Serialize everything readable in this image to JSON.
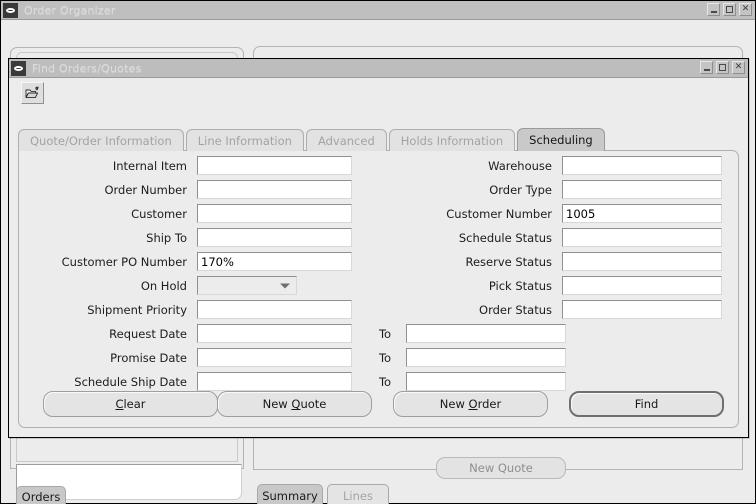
{
  "app_window": {
    "title": "Order Organizer",
    "window_controls": [
      "minimize",
      "maximize",
      "close"
    ],
    "bottom_tabs_left": [
      {
        "label": "Orders",
        "active": true
      }
    ],
    "bottom_tabs_right": [
      {
        "label": "Summary",
        "active": true
      },
      {
        "label": "Lines",
        "active": false
      }
    ],
    "obscured_button": {
      "label": "New Quote",
      "mnemonic": "Q"
    }
  },
  "dialog": {
    "title": "Find  Orders/Quotes",
    "window_controls": [
      "minimize",
      "maximize",
      "close"
    ],
    "toolbar": {
      "buttons": [
        {
          "name": "open-folder-icon",
          "label": ""
        }
      ]
    },
    "tabs": [
      {
        "label": "Quote/Order Information",
        "active": false
      },
      {
        "label": "Line Information",
        "active": false
      },
      {
        "label": "Advanced",
        "active": false
      },
      {
        "label": "Holds Information",
        "active": false
      },
      {
        "label": "Scheduling",
        "active": true
      }
    ],
    "left_fields": [
      {
        "label": "Internal Item",
        "value": "",
        "type": "text"
      },
      {
        "label": "Order Number",
        "value": "",
        "type": "text"
      },
      {
        "label": "Customer",
        "value": "",
        "type": "text"
      },
      {
        "label": "Ship To",
        "value": "",
        "type": "text"
      },
      {
        "label": "Customer PO Number",
        "value": "170%",
        "type": "text"
      },
      {
        "label": "On Hold",
        "value": "",
        "type": "combo"
      },
      {
        "label": "Shipment Priority",
        "value": "",
        "type": "text"
      }
    ],
    "date_fields": [
      {
        "label": "Request Date",
        "value": "",
        "to_label": "To",
        "to_value": ""
      },
      {
        "label": "Promise Date",
        "value": "",
        "to_label": "To",
        "to_value": ""
      },
      {
        "label": "Schedule Ship Date",
        "value": "",
        "to_label": "To",
        "to_value": ""
      }
    ],
    "right_fields": [
      {
        "label": "Warehouse",
        "value": "",
        "type": "text"
      },
      {
        "label": "Order Type",
        "value": "",
        "type": "text"
      },
      {
        "label": "Customer Number",
        "value": "1005",
        "type": "text"
      },
      {
        "label": "Schedule Status",
        "value": "",
        "type": "text"
      },
      {
        "label": "Reserve Status",
        "value": "",
        "type": "text"
      },
      {
        "label": "Pick Status",
        "value": "",
        "type": "text"
      },
      {
        "label": "Order Status",
        "value": "",
        "type": "text"
      }
    ],
    "buttons": [
      {
        "label": "Clear",
        "mnemonic": "C",
        "default": false
      },
      {
        "label": "New Quote",
        "mnemonic": "Q",
        "default": false
      },
      {
        "label": "New Order",
        "mnemonic": "O",
        "default": false
      },
      {
        "label": "Find",
        "mnemonic": "",
        "default": true
      }
    ]
  },
  "colors": {
    "window_bg": "#ececec",
    "titlebar_bg": "#bfbfbf",
    "titlebar_text": "#dcdcdc",
    "active_tab_bg": "#c9c9c9",
    "inactive_tab_bg": "#e2e2e2",
    "inactive_tab_text": "#a3a3a3",
    "input_bg": "#ffffff",
    "button_bg": "#e4e4e4"
  }
}
